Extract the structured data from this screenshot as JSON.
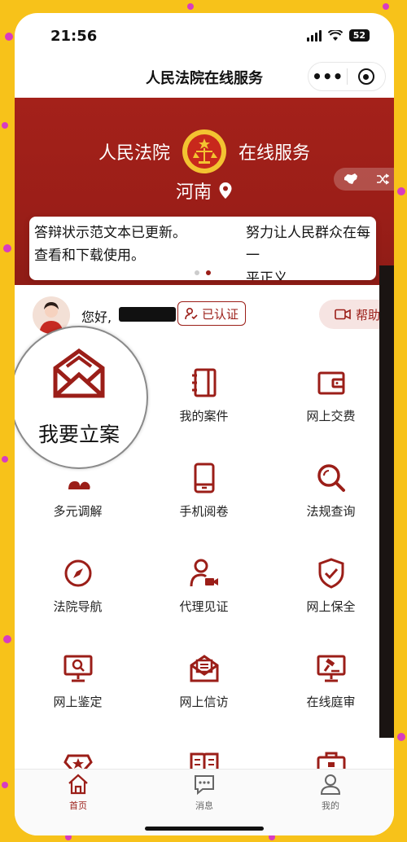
{
  "status_bar": {
    "time": "21:56",
    "battery": "52"
  },
  "nav": {
    "title": "人民法院在线服务",
    "more": "•••"
  },
  "banner": {
    "left_title": "人民法院",
    "right_title": "在线服务",
    "province": "河南",
    "notice_left": "答辩状示范文本已更新。\n查看和下载使用。",
    "notice_right": "努力让人民群众在每一\n平正义"
  },
  "user": {
    "greeting": "您好,",
    "verified_label": "已认证",
    "help_label": "帮助"
  },
  "magnified": {
    "label": "我要立案",
    "icon": "envelope-icon"
  },
  "grid": [
    {
      "label": "我的案件",
      "icon": "notebook-icon"
    },
    {
      "label": "网上交费",
      "icon": "wallet-icon"
    },
    {
      "label": "多元调解",
      "icon": "mediation-icon"
    },
    {
      "label": "手机阅卷",
      "icon": "phone-icon"
    },
    {
      "label": "法规查询",
      "icon": "search-icon"
    },
    {
      "label": "法院导航",
      "icon": "compass-icon"
    },
    {
      "label": "代理见证",
      "icon": "video-person-icon"
    },
    {
      "label": "网上保全",
      "icon": "shield-check-icon"
    },
    {
      "label": "网上鉴定",
      "icon": "monitor-search-icon"
    },
    {
      "label": "网上信访",
      "icon": "mail-letter-icon"
    },
    {
      "label": "在线庭审",
      "icon": "gavel-screen-icon"
    }
  ],
  "tabs": [
    {
      "label": "首页",
      "icon": "home-icon",
      "active": true
    },
    {
      "label": "消息",
      "icon": "message-icon",
      "active": false
    },
    {
      "label": "我的",
      "icon": "user-icon",
      "active": false
    }
  ],
  "colors": {
    "brand": "#9b1e18",
    "frame": "#f7c21a"
  }
}
